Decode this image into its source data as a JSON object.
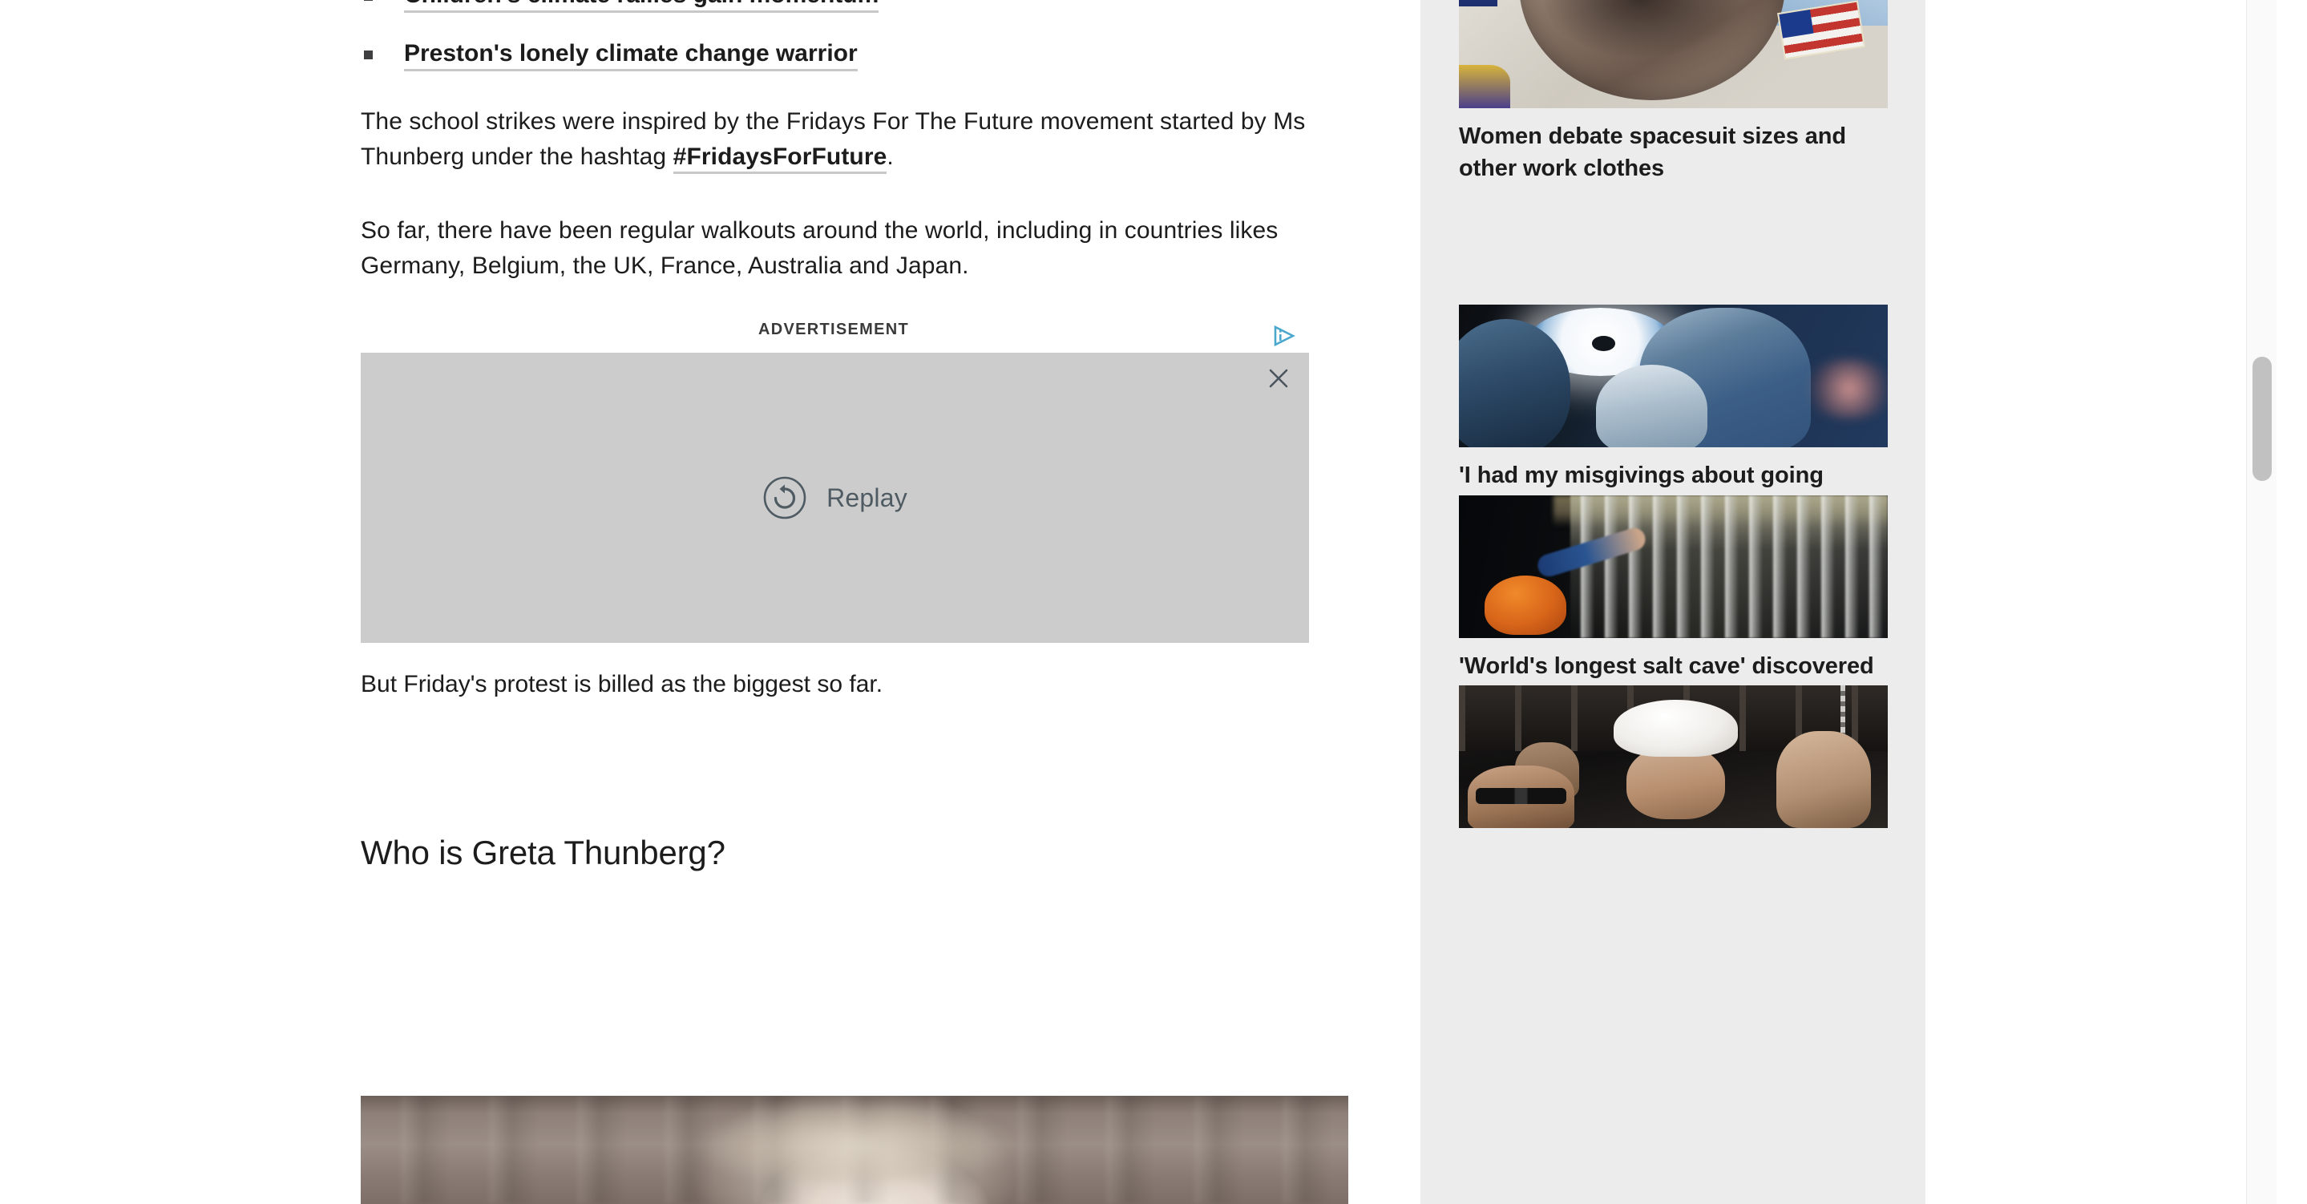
{
  "article": {
    "bullets": [
      {
        "text": "Children's climate rallies gain momentum"
      },
      {
        "text": "Preston's lonely climate change warrior"
      }
    ],
    "paragraph_1_part_1": "The school strikes were inspired by the Fridays For The Future movement started by Ms Thunberg under the hashtag ",
    "paragraph_1_hashtag": "#FridaysForFuture",
    "paragraph_1_part_2": ".",
    "paragraph_2": "So far, there have been regular walkouts around the world, including in countries likes Germany, Belgium, the UK, France, Australia and Japan.",
    "paragraph_3": "But Friday's protest is billed as the biggest so far.",
    "section_heading": "Who is Greta Thunberg?"
  },
  "advertisement": {
    "label": "ADVERTISEMENT",
    "adchoices_icon": "adchoices-triangle-icon",
    "close_icon": "close-x-icon",
    "replay_icon": "replay-circular-arrow-icon",
    "replay_label": "Replay",
    "background_color": "#cccccc",
    "replay_text_color": "#4f5b62",
    "adchoices_color": "#4aa8cd"
  },
  "sidebar": {
    "background_color": "#ececec",
    "items": [
      {
        "image_name": "astronaut-spacesuit-photo",
        "title": "Women debate spacesuit sizes and other work clothes"
      },
      {
        "image_name": "surgeons-in-operating-theatre-photo",
        "title": "'I had my misgivings about going abroad for surgery'"
      },
      {
        "image_name": "salt-cave-explorer-photo",
        "title": "'World's longest salt cave' discovered"
      },
      {
        "image_name": "man-in-white-hard-hat-photo",
        "title": ""
      }
    ]
  },
  "scrollbar": {
    "thumb_color": "#c1c1c1",
    "track_color": "#fafafa"
  }
}
